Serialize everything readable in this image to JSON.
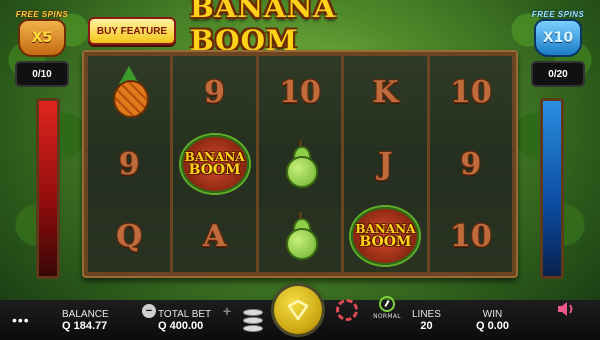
{
  "game": {
    "title": "BANANA BOOM",
    "buy_feature_label": "BUY FEATURE"
  },
  "free_spins_left": {
    "title": "FREE SPINS",
    "multiplier": "X5",
    "counter": "0/10"
  },
  "free_spins_right": {
    "title": "FREE SPINS",
    "multiplier": "X10",
    "counter": "0/20"
  },
  "reels": [
    [
      "pineapple",
      "9",
      "Q"
    ],
    [
      "9",
      "banana-boom",
      "A"
    ],
    [
      "10",
      "pear",
      "pear"
    ],
    [
      "K",
      "J",
      "banana-boom"
    ],
    [
      "10",
      "9",
      "10"
    ]
  ],
  "banana_boom_symbol": {
    "word1": "BANANA",
    "word2": "BOOM"
  },
  "bottom_bar": {
    "balance_label": "BALANCE",
    "balance_value": "Q 184.77",
    "total_bet_label": "TOTAL BET",
    "total_bet_value": "Q 400.00",
    "minus_symbol": "−",
    "plus_symbol": "+",
    "speed_label": "NORMAL",
    "lines_label": "LINES",
    "lines_value": "20",
    "win_label": "WIN",
    "win_value": "Q 0.00"
  },
  "icons": {
    "menu": "menu-icon",
    "coins": "coins-icon",
    "spin": "spin-icon",
    "autoplay": "autoplay-icon",
    "speed": "speed-gauge-icon",
    "sound": "sound-icon"
  },
  "colors": {
    "title": "#ffd21a",
    "buy_button": "#f2c418",
    "left_bar": "#e0251e",
    "right_bar": "#2a8fe0",
    "spin_button": "#f6df45",
    "autoplay": "#e04b55",
    "speed": "#7bd23a"
  }
}
